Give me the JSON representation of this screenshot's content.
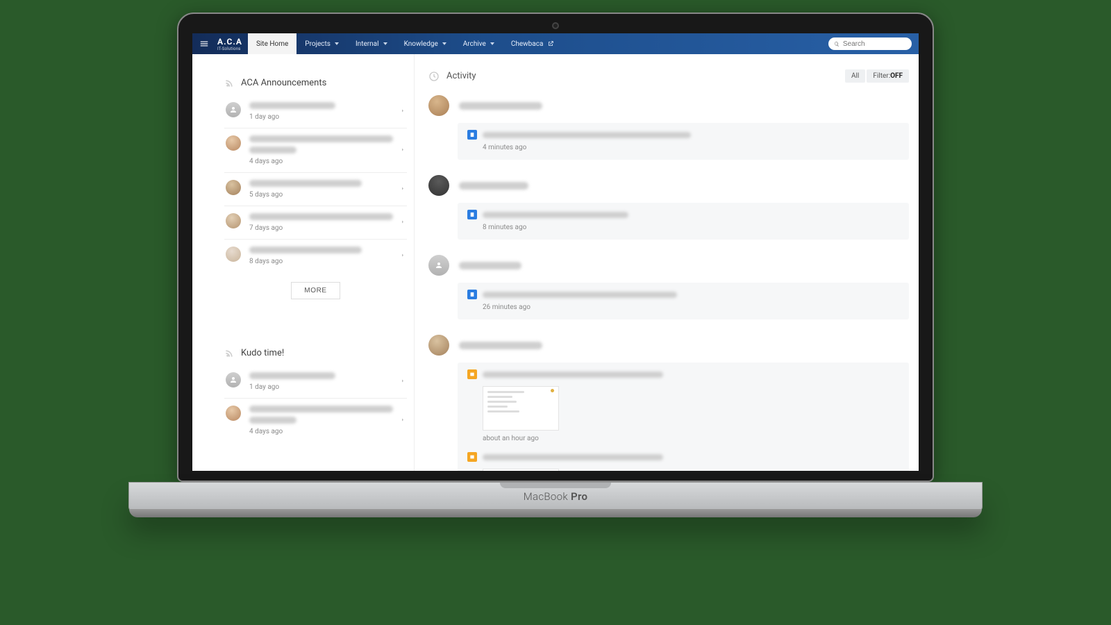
{
  "logo": {
    "line1": "A.C.A",
    "line2": "IT-Solutions"
  },
  "nav": {
    "site_home": "Site Home",
    "projects": "Projects",
    "internal": "Internal",
    "knowledge": "Knowledge",
    "archive": "Archive",
    "chewbaca": "Chewbaca"
  },
  "search": {
    "placeholder": "Search"
  },
  "left": {
    "announcements_title": "ACA Announcements",
    "items": [
      {
        "meta": "1 day ago"
      },
      {
        "meta": "4 days ago"
      },
      {
        "meta": "5 days ago"
      },
      {
        "meta": "7 days ago"
      },
      {
        "meta": "8 days ago"
      }
    ],
    "more": "MORE",
    "kudo_title": "Kudo time!",
    "kudo_items": [
      {
        "meta": "1 day ago"
      },
      {
        "meta": "4 days ago"
      }
    ]
  },
  "activity": {
    "title": "Activity",
    "filter_all": "All",
    "filter_label": "Filter:",
    "filter_state": "OFF",
    "events": [
      {
        "meta": "4 minutes ago"
      },
      {
        "meta": "8 minutes ago"
      },
      {
        "meta": "26 minutes ago"
      },
      {
        "meta": "about an hour ago"
      }
    ]
  },
  "device_label_a": "MacBook",
  "device_label_b": " Pro"
}
